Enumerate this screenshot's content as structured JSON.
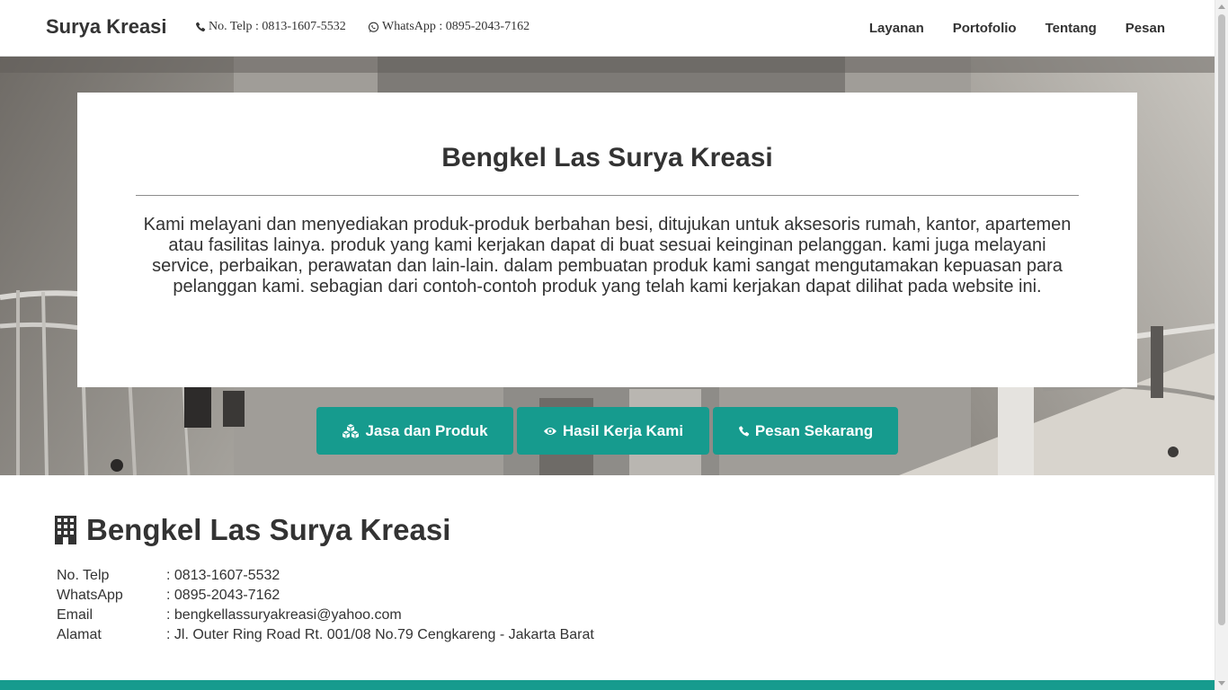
{
  "navbar": {
    "brand": "Surya Kreasi",
    "phone_text": "No. Telp : 0813-1607-5532",
    "whatsapp_text": "WhatsApp : 0895-2043-7162",
    "phone_icon": "phone-icon",
    "whatsapp_icon": "whatsapp-icon",
    "links": [
      {
        "label": "Layanan"
      },
      {
        "label": "Portofolio"
      },
      {
        "label": "Tentang"
      },
      {
        "label": "Pesan"
      }
    ]
  },
  "hero": {
    "title": "Bengkel Las Surya Kreasi",
    "description": "Kami melayani dan menyediakan produk-produk berbahan besi, ditujukan untuk aksesoris rumah, kantor, apartemen atau fasilitas lainya. produk yang kami kerjakan dapat di buat sesuai keinginan pelanggan. kami juga melayani service, perbaikan, perawatan dan lain-lain. dalam pembuatan produk kami sangat mengutamakan kepuasan para pelanggan kami. sebagian dari contoh-contoh produk yang telah kami kerjakan dapat dilihat pada website ini.",
    "buttons": [
      {
        "label": "Jasa dan Produk",
        "icon": "cubes-icon"
      },
      {
        "label": "Hasil Kerja Kami",
        "icon": "eye-icon"
      },
      {
        "label": "Pesan Sekarang",
        "icon": "phone-icon"
      }
    ]
  },
  "contact": {
    "title": "Bengkel Las Surya Kreasi",
    "title_icon": "building-icon",
    "rows": [
      {
        "label": "No. Telp",
        "value": ": 0813-1607-5532"
      },
      {
        "label": "WhatsApp",
        "value": ": 0895-2043-7162"
      },
      {
        "label": "Email",
        "value": ": bengkellassuryakreasi@yahoo.com"
      },
      {
        "label": "Alamat",
        "value": ": Jl. Outer Ring Road Rt. 001/08 No.79 Cengkareng - Jakarta Barat"
      }
    ]
  },
  "colors": {
    "accent": "#169b8e",
    "text": "#333333",
    "background": "#ffffff"
  }
}
